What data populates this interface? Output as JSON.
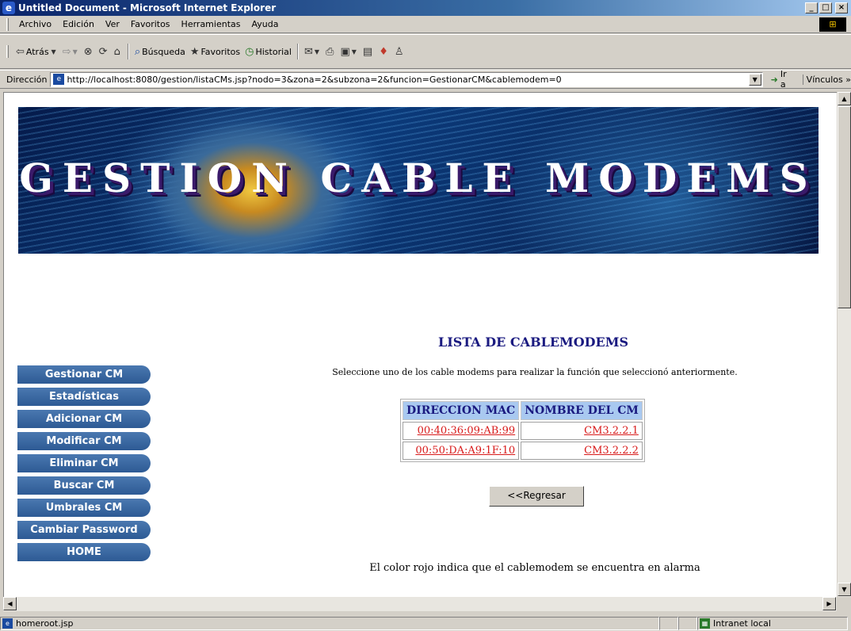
{
  "window": {
    "title": "Untitled Document - Microsoft Internet Explorer",
    "controls": {
      "minimize": "_",
      "maximize": "□",
      "close": "×"
    }
  },
  "menu": [
    "Archivo",
    "Edición",
    "Ver",
    "Favoritos",
    "Herramientas",
    "Ayuda"
  ],
  "toolbar": {
    "back": "Atrás",
    "search": "Búsqueda",
    "favorites": "Favoritos",
    "history": "Historial"
  },
  "address": {
    "label": "Dirección",
    "url": "http://localhost:8080/gestion/listaCMs.jsp?nodo=3&zona=2&subzona=2&funcion=GestionarCM&cablemodem=0",
    "go": "Ir a",
    "links": "Vínculos"
  },
  "banner": {
    "title": "GESTION CABLE MODEMS"
  },
  "sidebar": {
    "items": [
      {
        "label": "Gestionar CM"
      },
      {
        "label": "Estadísticas"
      },
      {
        "label": "Adicionar CM"
      },
      {
        "label": "Modificar CM"
      },
      {
        "label": "Eliminar CM"
      },
      {
        "label": "Buscar CM"
      },
      {
        "label": "Umbrales CM"
      },
      {
        "label": "Cambiar Password"
      },
      {
        "label": "HOME"
      }
    ]
  },
  "main": {
    "title": "LISTA DE CABLEMODEMS",
    "instruction": "Seleccione uno de los cable modems para realizar la función que seleccionó anteriormente.",
    "table": {
      "headers": [
        "DIRECCION MAC",
        "NOMBRE DEL CM"
      ],
      "rows": [
        [
          "00:40:36:09:AB:99",
          "CM3.2.2.1"
        ],
        [
          "00:50:DA:A9:1F:10",
          "CM3.2.2.2"
        ]
      ]
    },
    "back_button": "<<Regresar",
    "note": "El color rojo indica que el cablemodem se encuentra en alarma"
  },
  "status": {
    "text": "homeroot.jsp",
    "zone": "Intranet local"
  },
  "colors": {
    "sidebar_button": "#2d5a94",
    "alarm_link": "#d81a1a",
    "table_header": "#a9c9f0",
    "title_blue": "#1a1a80"
  }
}
